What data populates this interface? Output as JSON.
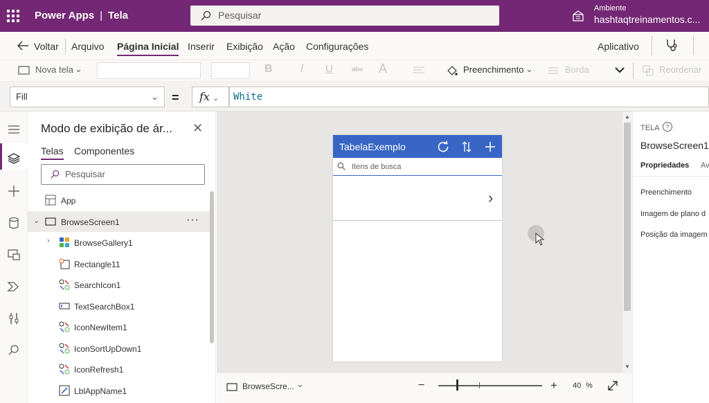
{
  "header": {
    "app_name": "Power Apps",
    "separator": "|",
    "context": "Tela",
    "search_placeholder": "Pesquisar",
    "environment_label": "Ambiente",
    "environment_name": "hashtaqtreinamentos.c..."
  },
  "menu": {
    "back": "Voltar",
    "items": [
      "Arquivo",
      "Página Inicial",
      "Inserir",
      "Exibição",
      "Ação",
      "Configurações"
    ],
    "active": "Página Inicial",
    "right": "Aplicativo"
  },
  "toolbar": {
    "new_screen": "Nova tela",
    "bold": "B",
    "italic": "/",
    "underline": "U",
    "strike": "abc",
    "font_color": "A",
    "fill": "Preenchimento",
    "border": "Borda",
    "reorder": "Reordenar"
  },
  "formula": {
    "property": "Fill",
    "equals": "=",
    "fx": "fx",
    "value": "White"
  },
  "tree": {
    "title": "Modo de exibição de ár...",
    "tabs": [
      "Telas",
      "Componentes"
    ],
    "search_placeholder": "Pesquisar",
    "app": "App",
    "screen": "BrowseScreen1",
    "more": "···",
    "controls": [
      "BrowseGallery1",
      "Rectangle11",
      "SearchIcon1",
      "TextSearchBox1",
      "IconNewItem1",
      "IconSortUpDown1",
      "IconRefresh1",
      "LblAppName1"
    ]
  },
  "canvas": {
    "app_title": "TabelaExemplo",
    "search_placeholder": "Itens de busca"
  },
  "status": {
    "screen": "BrowseScre...",
    "zoom_minus": "−",
    "zoom_plus": "+",
    "zoom_value": "40",
    "zoom_unit": "%"
  },
  "properties": {
    "section": "TELA",
    "name": "BrowseScreen1",
    "tab_active": "Propriedades",
    "tab_next": "Av",
    "rows": [
      "Preenchimento",
      "Imagem de plano d",
      "Posição da imagem"
    ]
  },
  "colors": {
    "brand": "#742774",
    "header_blue": "#3966c6"
  }
}
